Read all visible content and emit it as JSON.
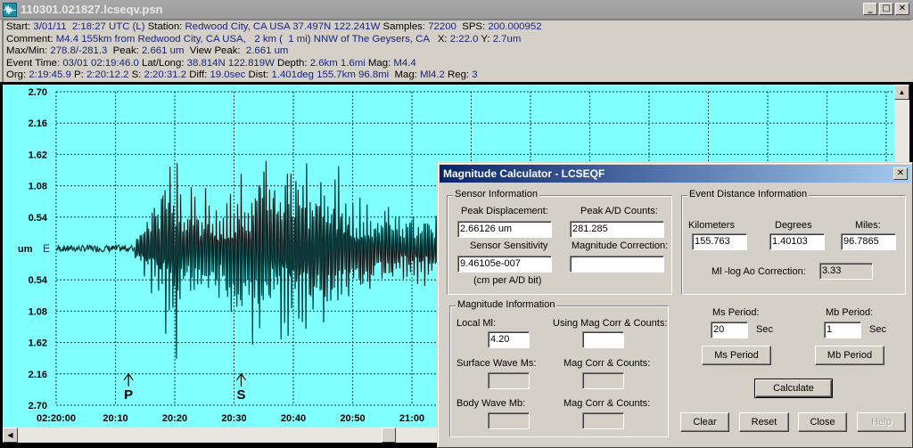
{
  "window": {
    "title": "110301.021827.lcseqv.psn",
    "controls": [
      "_",
      "□",
      "✕"
    ]
  },
  "info": {
    "line1": [
      {
        "k": "Start: ",
        "v": "3/01/11  2:18:27 UTC (L)"
      },
      {
        "k": " Station: ",
        "v": "Redwood City, CA USA 37.497N 122.241W"
      },
      {
        "k": " Samples: ",
        "v": "72200"
      },
      {
        "k": "  SPS: ",
        "v": "200.000952"
      }
    ],
    "line2": [
      {
        "k": "Comment: ",
        "v": "M4.4 155km from Redwood City, CA USA,   2 km (  1 mi) NNW of The Geysers, CA"
      },
      {
        "k": "   X: ",
        "v": "2:22.0"
      },
      {
        "k": " Y: ",
        "v": "2.7um"
      }
    ],
    "line3": [
      {
        "k": "Max/Min: ",
        "v": "278.8/-281.3"
      },
      {
        "k": "  Peak: ",
        "v": "2.661 um"
      },
      {
        "k": "  View Peak:  ",
        "v": "2.661 um"
      }
    ],
    "line4": [
      {
        "k": "Event Time: ",
        "v": "03/01 02:19:46.0"
      },
      {
        "k": " Lat/Long: ",
        "v": "38.814N 122.819W"
      },
      {
        "k": " Depth: ",
        "v": "2.6km 1.6mi"
      },
      {
        "k": " Mag: ",
        "v": "M4.4"
      }
    ],
    "line5": [
      {
        "k": "Org: ",
        "v": "2:19:45.9"
      },
      {
        "k": " P: ",
        "v": "2:20:12.2"
      },
      {
        "k": " S: ",
        "v": "2:20:31.2"
      },
      {
        "k": " Diff: ",
        "v": "19.0sec"
      },
      {
        "k": " Dist: ",
        "v": "1.401deg 155.7km 96.8mi"
      },
      {
        "k": "  Mag: ",
        "v": "Ml4.2"
      },
      {
        "k": " Reg: ",
        "v": "3"
      }
    ]
  },
  "chart_data": {
    "type": "line",
    "title": "",
    "channel_label": "E",
    "ylabel": "um",
    "ylim": [
      -2.7,
      2.7
    ],
    "y_ticks": [
      "2.70",
      "2.16",
      "1.62",
      "1.08",
      "0.54",
      "",
      "0.54",
      "1.08",
      "1.62",
      "2.16",
      "2.70"
    ],
    "y_tick_values": [
      2.7,
      2.16,
      1.62,
      1.08,
      0.54,
      0,
      -0.54,
      -1.08,
      -1.62,
      -2.16,
      -2.7
    ],
    "x_ticks": [
      "02:20:00",
      "20:10",
      "20:20",
      "20:30",
      "20:40",
      "20:50",
      "21:00"
    ],
    "x_tick_seconds": [
      0,
      10,
      20,
      30,
      40,
      50,
      60
    ],
    "x_range_seconds": [
      -9,
      141
    ],
    "grid": true,
    "markers": [
      {
        "label": "P",
        "time_s": 12.2
      },
      {
        "label": "S",
        "time_s": 31.2
      }
    ],
    "series": [
      {
        "name": "E",
        "description": "seismogram trace; noise before P arrival, large oscillations after ~14s",
        "envelope": [
          {
            "t": -9,
            "amp": 0.05
          },
          {
            "t": 13,
            "amp": 0.06
          },
          {
            "t": 14,
            "amp": 0.6
          },
          {
            "t": 17,
            "amp": 1.2
          },
          {
            "t": 19.5,
            "amp": 2.66
          },
          {
            "t": 21,
            "amp": 1.6
          },
          {
            "t": 25,
            "amp": 1.2
          },
          {
            "t": 29,
            "amp": 1.3
          },
          {
            "t": 34,
            "amp": 2.1
          },
          {
            "t": 40,
            "amp": 2.0
          },
          {
            "t": 46,
            "amp": 1.9
          },
          {
            "t": 50,
            "amp": 1.1
          },
          {
            "t": 58,
            "amp": 0.9
          },
          {
            "t": 70,
            "amp": 0.7
          }
        ]
      }
    ]
  },
  "dialog": {
    "title": "Magnitude Calculator - LCSEQF",
    "close": "✕",
    "sensor": {
      "legend": "Sensor Information",
      "peak_disp_label": "Peak Displacement:",
      "peak_disp_value": "2.66126 um",
      "peak_ad_label": "Peak A/D Counts:",
      "peak_ad_value": "281.285",
      "sensitivity_label": "Sensor Sensitivity",
      "sensitivity_value": "9.46105e-007",
      "sensitivity_unit": "(cm per A/D bit)",
      "mag_corr_label": "Magnitude Correction:",
      "mag_corr_value": ""
    },
    "distance": {
      "legend": "Event Distance Information",
      "km_label": "Kilometers",
      "km_value": "155.763",
      "deg_label": "Degrees",
      "deg_value": "1.40103",
      "mi_label": "Miles:",
      "mi_value": "96.7865",
      "logao_label": "Ml -log Ao Correction:",
      "logao_value": "3.33"
    },
    "magnitude": {
      "legend": "Magnitude Information",
      "local_label": "Local Ml:",
      "local_value": "4.20",
      "using_label": "Using Mag Corr & Counts:",
      "using_value": "",
      "ms_label": "Surface Wave Ms:",
      "ms_value": "",
      "ms_corr_label": "Mag Corr & Counts:",
      "ms_corr_value": "",
      "mb_label": "Body Wave Mb:",
      "mb_value": "",
      "mb_corr_label": "Mag Corr & Counts:",
      "mb_corr_value": ""
    },
    "periods": {
      "ms_period_label": "Ms Period:",
      "ms_period_value": "20",
      "mb_period_label": "Mb Period:",
      "mb_period_value": "1",
      "sec_unit": "Sec",
      "ms_button": "Ms Period",
      "mb_button": "Mb Period"
    },
    "buttons": {
      "calculate": "Calculate",
      "clear": "Clear",
      "reset": "Reset",
      "close": "Close",
      "help": "Help"
    }
  },
  "colors": {
    "plot_bg": "#80ffff",
    "trace": "#000000",
    "trace_fill": "#2a8a8a",
    "value_text": "#1a237e",
    "dialog_title": "#0a246a"
  }
}
